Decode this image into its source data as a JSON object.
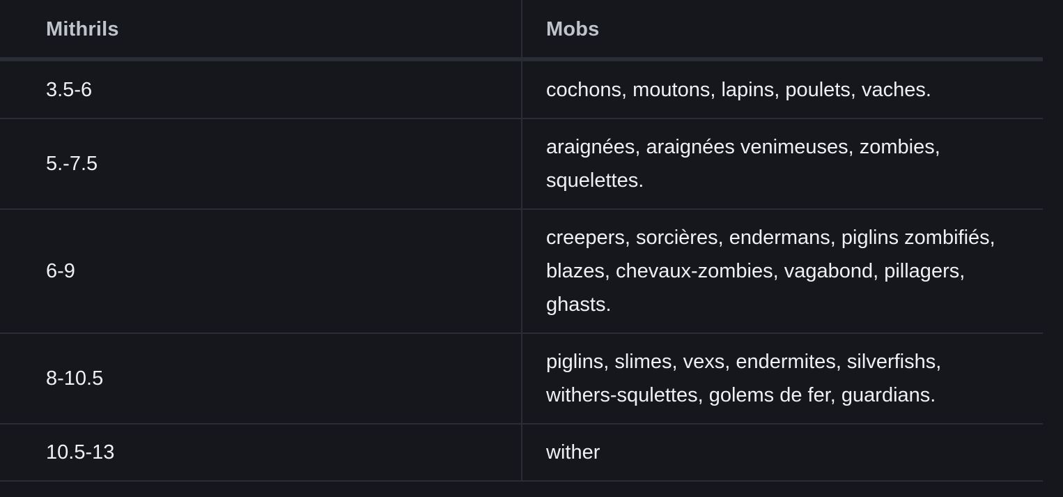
{
  "table": {
    "headers": [
      "Mithrils",
      "Mobs"
    ],
    "rows": [
      {
        "mithrils": "3.5-6",
        "mobs": "cochons, moutons, lapins, poulets, vaches."
      },
      {
        "mithrils": "5.-7.5",
        "mobs": "araignées, araignées venimeuses, zombies, squelettes."
      },
      {
        "mithrils": "6-9",
        "mobs": "creepers, sorcières, endermans, piglins zombifiés, blazes, chevaux-zombies, vagabond, pillagers, ghasts."
      },
      {
        "mithrils": "8-10.5",
        "mobs": "piglins, slimes, vexs, endermites, silverfishs, withers-squlettes, golems de fer, guardians."
      },
      {
        "mithrils": "10.5-13",
        "mobs": "wither"
      }
    ]
  }
}
